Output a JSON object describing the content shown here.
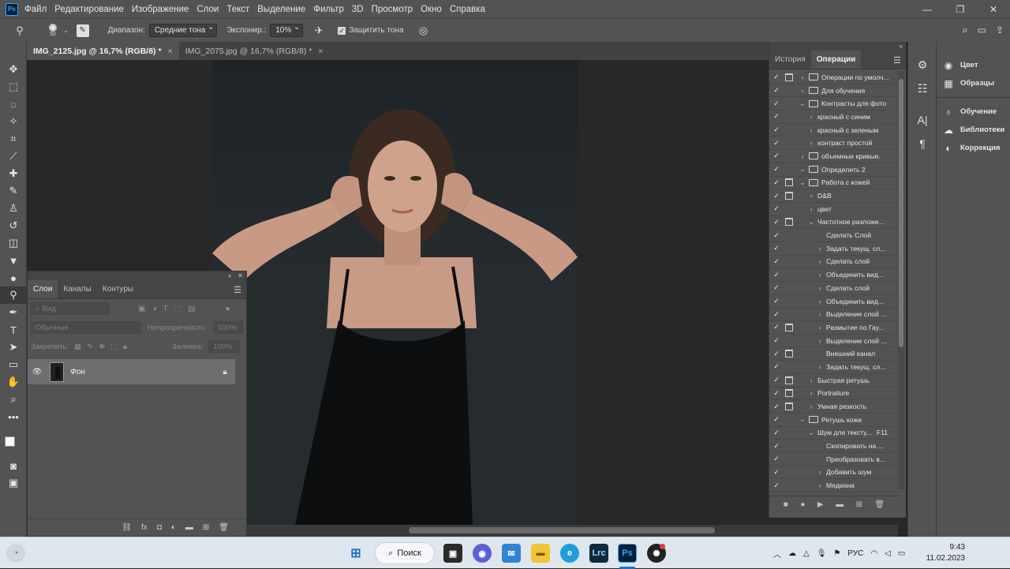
{
  "app": {
    "logo": "Ps"
  },
  "menu": [
    "Файл",
    "Редактирование",
    "Изображение",
    "Слои",
    "Текст",
    "Выделение",
    "Фильтр",
    "3D",
    "Просмотр",
    "Окно",
    "Справка"
  ],
  "window_controls": {
    "minimize": "—",
    "restore": "❐",
    "close": "✕"
  },
  "options": {
    "brush_size": "50",
    "range_label": "Диапазон:",
    "range_value": "Средние тона",
    "exposure_label": "Экспонир.:",
    "exposure_value": "10%",
    "protect_tones_label": "Защитить тона",
    "protect_tones_checked": true
  },
  "tabs": [
    {
      "label": "IMG_2125.jpg @ 16,7% (RGB/8) *",
      "close": "×"
    },
    {
      "label": "IMG_2075.jpg @ 16,7% (RGB/8) *",
      "close": "×"
    }
  ],
  "layers_panel": {
    "tabs": [
      "Слои",
      "Каналы",
      "Контуры"
    ],
    "filter_placeholder": "Вид",
    "blend_mode": "Обычные",
    "opacity_label": "Непрозрачность:",
    "opacity_value": "100%",
    "lock_label": "Закрепить:",
    "fill_label": "Заливка:",
    "fill_value": "100%",
    "layers": [
      {
        "name": "Фон",
        "visible": true,
        "locked": true
      }
    ]
  },
  "actions_panel": {
    "tabs": [
      "История",
      "Операции"
    ],
    "items": [
      {
        "label": "Операции по умолч...",
        "indent": 0,
        "folder": true,
        "arrow": "›",
        "dialog": true
      },
      {
        "label": "Для обучения",
        "indent": 0,
        "folder": true,
        "arrow": "›",
        "dialog": false
      },
      {
        "label": "Контрасты для фото",
        "indent": 0,
        "folder": true,
        "arrow": "⌄",
        "dialog": false
      },
      {
        "label": "красный с синим",
        "indent": 1,
        "folder": false,
        "arrow": "›",
        "dialog": false
      },
      {
        "label": "красный с зеленым",
        "indent": 1,
        "folder": false,
        "arrow": "›",
        "dialog": false
      },
      {
        "label": "контраст простой",
        "indent": 1,
        "folder": false,
        "arrow": "›",
        "dialog": false
      },
      {
        "label": "объемные кривые.",
        "indent": 0,
        "folder": true,
        "arrow": "›",
        "dialog": false
      },
      {
        "label": "Определить 2",
        "indent": 0,
        "folder": true,
        "arrow": "⌄",
        "dialog": false
      },
      {
        "label": "Работа с кожей",
        "indent": 0,
        "folder": true,
        "arrow": "⌄",
        "dialog": true
      },
      {
        "label": "D&B",
        "indent": 1,
        "folder": false,
        "arrow": "›",
        "dialog": true
      },
      {
        "label": "цвет",
        "indent": 1,
        "folder": false,
        "arrow": "›",
        "dialog": false
      },
      {
        "label": "Частотное разложе...",
        "indent": 1,
        "folder": false,
        "arrow": "⌄",
        "dialog": true
      },
      {
        "label": "Сделать Слой",
        "indent": 2,
        "folder": false,
        "arrow": "",
        "dialog": false
      },
      {
        "label": "Задать текущ. сл...",
        "indent": 2,
        "folder": false,
        "arrow": "›",
        "dialog": false
      },
      {
        "label": "Сделать слой",
        "indent": 2,
        "folder": false,
        "arrow": "›",
        "dialog": false
      },
      {
        "label": "Объединить вид...",
        "indent": 2,
        "folder": false,
        "arrow": "›",
        "dialog": false
      },
      {
        "label": "Сделать слой",
        "indent": 2,
        "folder": false,
        "arrow": "›",
        "dialog": false
      },
      {
        "label": "Объединить вид...",
        "indent": 2,
        "folder": false,
        "arrow": "›",
        "dialog": false
      },
      {
        "label": "Выделение слой ...",
        "indent": 2,
        "folder": false,
        "arrow": "›",
        "dialog": false
      },
      {
        "label": "Размытие по Гау...",
        "indent": 2,
        "folder": false,
        "arrow": "›",
        "dialog": true
      },
      {
        "label": "Выделение слой ...",
        "indent": 2,
        "folder": false,
        "arrow": "›",
        "dialog": false
      },
      {
        "label": "Внешний канал",
        "indent": 2,
        "folder": false,
        "arrow": "",
        "dialog": true
      },
      {
        "label": "Задать текущ. сл...",
        "indent": 2,
        "folder": false,
        "arrow": "›",
        "dialog": false
      },
      {
        "label": "Быстрая ретушь",
        "indent": 1,
        "folder": false,
        "arrow": "›",
        "dialog": true
      },
      {
        "label": "Portraiture",
        "indent": 1,
        "folder": false,
        "arrow": "›",
        "dialog": true
      },
      {
        "label": "Умная резкость",
        "indent": 1,
        "folder": false,
        "arrow": "›",
        "dialog": true
      },
      {
        "label": "Ретушь кожи",
        "indent": 0,
        "folder": true,
        "arrow": "⌄",
        "dialog": false
      },
      {
        "label": "Шум для тексту...",
        "indent": 1,
        "folder": false,
        "arrow": "⌄",
        "dialog": false,
        "shortcut": "F11"
      },
      {
        "label": "Скопировать на ...",
        "indent": 2,
        "folder": false,
        "arrow": "",
        "dialog": false
      },
      {
        "label": "Преобразовать в...",
        "indent": 2,
        "folder": false,
        "arrow": "",
        "dialog": false
      },
      {
        "label": "Добавить шум",
        "indent": 2,
        "folder": false,
        "arrow": "›",
        "dialog": false
      },
      {
        "label": "Медиана",
        "indent": 2,
        "folder": false,
        "arrow": "›",
        "dialog": false
      }
    ]
  },
  "right_panel": {
    "group1": [
      "Цвет",
      "Образцы"
    ],
    "group2": [
      "Обучение",
      "Библиотеки",
      "Коррекция"
    ]
  },
  "taskbar": {
    "search_label": "Поиск",
    "lang": "РУС",
    "time": "9:43",
    "date": "11.02.2023",
    "lrc_label": "Lrc",
    "ps_label": "Ps"
  }
}
